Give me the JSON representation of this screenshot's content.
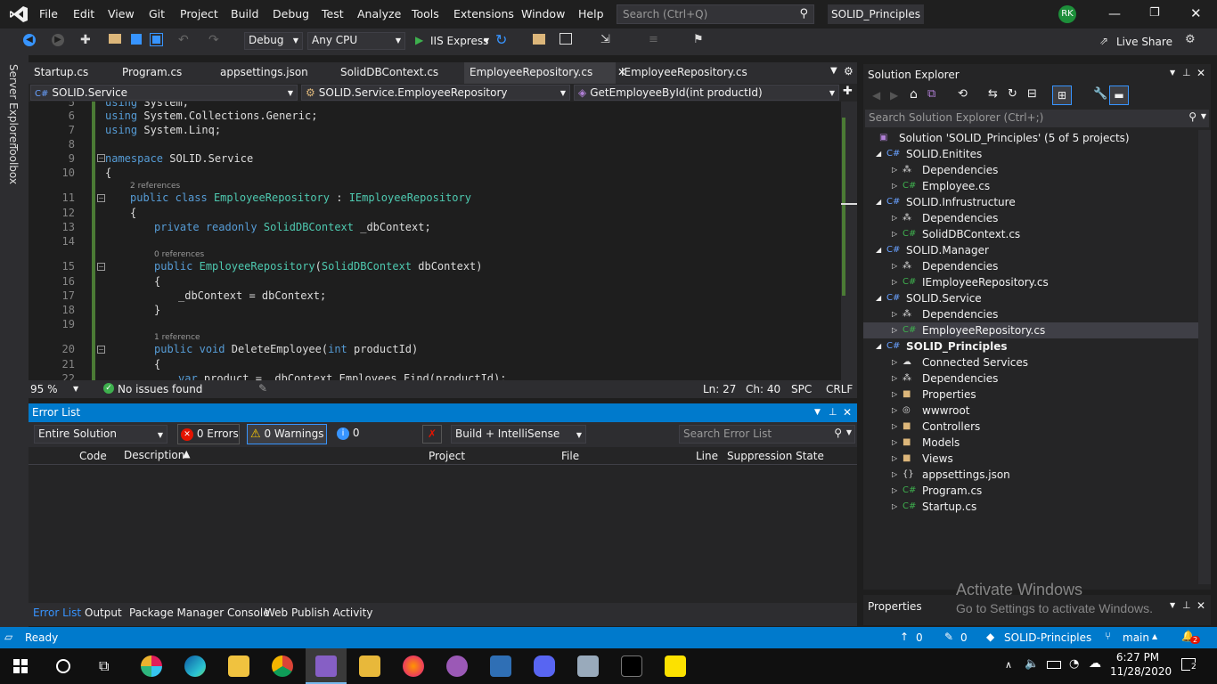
{
  "menu": [
    "File",
    "Edit",
    "View",
    "Git",
    "Project",
    "Build",
    "Debug",
    "Test",
    "Analyze",
    "Tools",
    "Extensions",
    "Window",
    "Help"
  ],
  "search": {
    "placeholder": "Search (Ctrl+Q)"
  },
  "window_title": "SOLID_Principles",
  "user_initials": "RK",
  "toolbar": {
    "config": "Debug",
    "platform": "Any CPU",
    "run_label": "IIS Express",
    "live_share": "Live Share"
  },
  "tabs": [
    "Startup.cs",
    "Program.cs",
    "appsettings.json",
    "SolidDBContext.cs",
    "EmployeeRepository.cs",
    "IEmployeeRepository.cs"
  ],
  "nav": {
    "project": "SOLID.Service",
    "class": "SOLID.Service.EmployeeRepository",
    "member": "GetEmployeeById(int productId)"
  },
  "editor": {
    "lines": [
      "5",
      "6",
      "7",
      "8",
      "9",
      "10",
      "11",
      "12",
      "13",
      "14",
      "15",
      "16",
      "17",
      "18",
      "19",
      "20",
      "21",
      "22"
    ],
    "refs": {
      "class": "2 references",
      "ctor": "0 references",
      "method": "1 reference"
    }
  },
  "status_line": {
    "zoom": "95 %",
    "issues": "No issues found",
    "ln": "Ln: 27",
    "ch": "Ch: 40",
    "spc": "SPC",
    "crlf": "CRLF"
  },
  "error_list": {
    "title": "Error List",
    "scope": "Entire Solution",
    "errors": "0 Errors",
    "warnings": "0 Warnings",
    "messages": "0 Messages",
    "source": "Build + IntelliSense",
    "search_placeholder": "Search Error List",
    "columns": [
      "Code",
      "Description",
      "Project",
      "File",
      "Line",
      "Suppression State"
    ]
  },
  "bottom_tabs": [
    "Error List",
    "Output",
    "Package Manager Console",
    "Web Publish Activity"
  ],
  "side_tabs": [
    "Server Explorer",
    "Toolbox"
  ],
  "solution_explorer": {
    "title": "Solution Explorer",
    "search_placeholder": "Search Solution Explorer (Ctrl+;)",
    "items": [
      {
        "label": "Solution 'SOLID_Principles' (5 of 5 projects)",
        "depth": 0
      },
      {
        "label": "SOLID.Enitites",
        "depth": 1
      },
      {
        "label": "Dependencies",
        "depth": 2
      },
      {
        "label": "Employee.cs",
        "depth": 2
      },
      {
        "label": "SOLID.Infrustructure",
        "depth": 1
      },
      {
        "label": "Dependencies",
        "depth": 2
      },
      {
        "label": "SolidDBContext.cs",
        "depth": 2
      },
      {
        "label": "SOLID.Manager",
        "depth": 1
      },
      {
        "label": "Dependencies",
        "depth": 2
      },
      {
        "label": "IEmployeeRepository.cs",
        "depth": 2
      },
      {
        "label": "SOLID.Service",
        "depth": 1
      },
      {
        "label": "Dependencies",
        "depth": 2
      },
      {
        "label": "EmployeeRepository.cs",
        "depth": 2
      },
      {
        "label": "SOLID_Principles",
        "depth": 1
      },
      {
        "label": "Connected Services",
        "depth": 2
      },
      {
        "label": "Dependencies",
        "depth": 2
      },
      {
        "label": "Properties",
        "depth": 2
      },
      {
        "label": "wwwroot",
        "depth": 2
      },
      {
        "label": "Controllers",
        "depth": 2
      },
      {
        "label": "Models",
        "depth": 2
      },
      {
        "label": "Views",
        "depth": 2
      },
      {
        "label": "appsettings.json",
        "depth": 2
      },
      {
        "label": "Program.cs",
        "depth": 2
      },
      {
        "label": "Startup.cs",
        "depth": 2
      }
    ]
  },
  "properties_title": "Properties",
  "watermark": {
    "line1": "Activate Windows",
    "line2": "Go to Settings to activate Windows."
  },
  "status_bar": {
    "ready": "Ready",
    "up": "0",
    "pencil": "0",
    "repo": "SOLID-Principles",
    "branch": "main",
    "notifications": "2"
  },
  "clock": {
    "time": "6:27 PM",
    "date": "11/28/2020",
    "badge": "2"
  },
  "colors": {
    "accent": "#007acc",
    "keyword": "#569cd6",
    "type": "#4ec9b0"
  }
}
